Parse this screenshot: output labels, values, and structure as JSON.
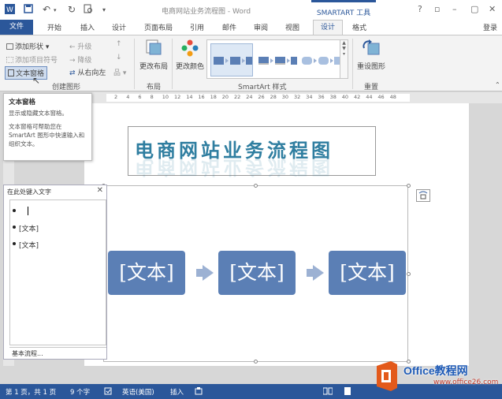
{
  "window": {
    "title": "电商网站业务流程图 - Word",
    "contextual_tab": "SMARTART 工具",
    "buttons": [
      "?",
      "▫",
      "–",
      "▢",
      "✕"
    ]
  },
  "tabs": {
    "file": "文件",
    "items": [
      "开始",
      "插入",
      "设计",
      "页面布局",
      "引用",
      "邮件",
      "审阅",
      "视图"
    ],
    "active_design": "设计",
    "format": "格式",
    "login": "登录"
  },
  "ribbon": {
    "create_graphic": {
      "add_shape": "添加形状",
      "add_bullet": "添加项目符号",
      "text_pane": "文本窗格",
      "promote": "升级",
      "demote": "降级",
      "right_to_left": "从右向左",
      "label": "创建图形"
    },
    "layouts": {
      "change_layout": "更改布局",
      "label": "布局"
    },
    "styles": {
      "change_colors": "更改颜色",
      "label": "SmartArt 样式"
    },
    "reset": {
      "reset_graphic": "重设图形",
      "label": "重置"
    }
  },
  "tooltip": {
    "title": "文本窗格",
    "line1": "显示或隐藏文本窗格。",
    "line2": "文本窗格可帮助您在 SmartArt 图形中快速输入和组织文本。"
  },
  "ruler": [
    "2",
    "4",
    "6",
    "8",
    "10",
    "12",
    "14",
    "16",
    "18",
    "20",
    "22",
    "24",
    "26",
    "28",
    "30",
    "32",
    "34",
    "36",
    "38",
    "40",
    "42",
    "44",
    "46",
    "48"
  ],
  "document": {
    "heading": "电商网站业务流程图",
    "smartart_boxes": [
      "[文本]",
      "[文本]",
      "[文本]"
    ]
  },
  "text_pane": {
    "title": "在此处键入文字",
    "close": "✕",
    "bullets": [
      "",
      "[文本]",
      "[文本]"
    ],
    "footer": "基本流程..."
  },
  "status": {
    "page": "第 1 页，共 1 页",
    "words": "9 个字",
    "language": "英语(美国)",
    "mode": "插入"
  },
  "watermark": {
    "name": "Office教程网",
    "url": "www.office26.com"
  },
  "colors": {
    "brand": "#2b579a",
    "smartart_fill": "#5b7fb5",
    "arrow": "#9cb1d3",
    "heading": "#2f7ea0"
  }
}
